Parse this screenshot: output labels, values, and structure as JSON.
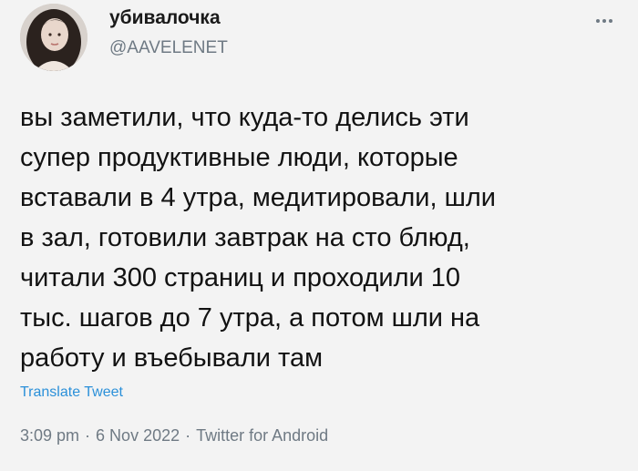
{
  "tweet": {
    "author": {
      "display_name": "убивалочка",
      "handle": "@AAVELENET",
      "avatar_icon": "profile-photo"
    },
    "more_icon": "ellipsis-icon",
    "text": "вы заметили, что куда-то делись эти\nсупер продуктивные люди, которые\nвставали в 4 утра, медитировали, шли\nв зал, готовили завтрак на сто блюд,\nчитали 300 страниц и проходили 10\nтыс. шагов до 7 утра, а потом шли на\nработу и въебывали там",
    "translate_label": "Translate Tweet",
    "time": "3:09 pm",
    "date": "6 Nov 2022",
    "source": "Twitter for Android",
    "separator": "·"
  },
  "colors": {
    "background": "#f3f3f3",
    "text": "#121212",
    "secondary": "#6f7a84",
    "link": "#2b90d9"
  }
}
